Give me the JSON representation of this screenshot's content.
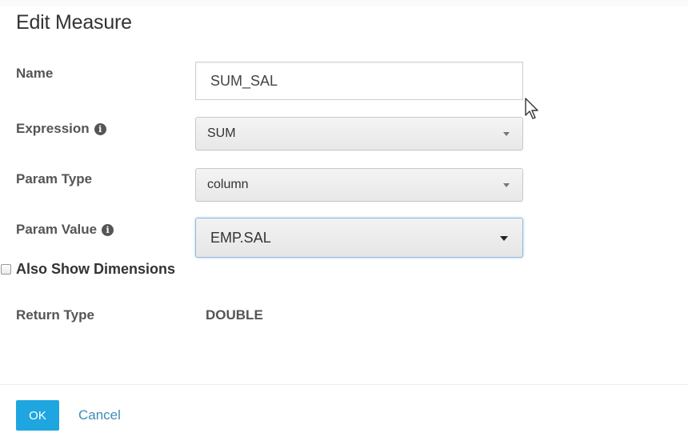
{
  "dialog": {
    "title": "Edit Measure"
  },
  "form": {
    "name": {
      "label": "Name",
      "value": "SUM_SAL"
    },
    "expression": {
      "label": "Expression",
      "value": "SUM"
    },
    "param_type": {
      "label": "Param Type",
      "value": "column"
    },
    "param_value": {
      "label": "Param Value",
      "value": "EMP.SAL"
    },
    "also_show_dimensions": {
      "label": "Also Show Dimensions",
      "checked": false
    },
    "return_type": {
      "label": "Return Type",
      "value": "DOUBLE"
    }
  },
  "footer": {
    "ok_label": "OK",
    "cancel_label": "Cancel"
  },
  "colors": {
    "primary_button": "#1fa6e0",
    "link": "#3c8dbc",
    "label_text": "#555555"
  }
}
